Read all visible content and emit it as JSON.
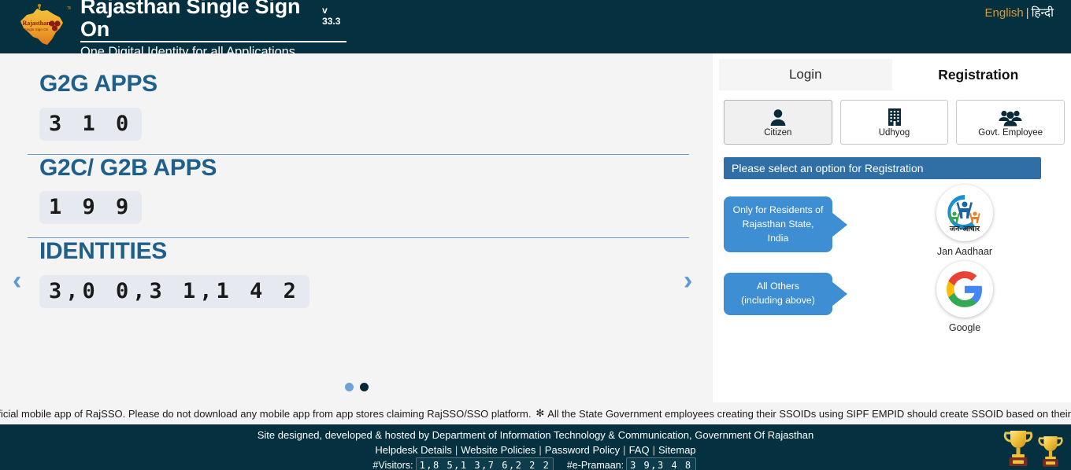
{
  "header": {
    "logo_alt": "rajasthan-sso-emblem",
    "title": "Rajasthan Single Sign On",
    "version": "v 33.3",
    "subtitle": "One Digital Identity for all Applications",
    "lang_english": "English",
    "lang_separator": "|",
    "lang_hindi": "हिन्दी",
    "bg_color": "#04303f",
    "accent_color": "#d79a3a"
  },
  "stats": {
    "items": [
      {
        "title": "G2G APPS",
        "value": "3 1 0"
      },
      {
        "title": "G2C/ G2B APPS",
        "value": "1 9 9"
      },
      {
        "title": "IDENTITIES",
        "value": "3,0 0,3 1,1 4 2"
      }
    ],
    "prev_arrow": "‹",
    "next_arrow": "›",
    "dots": 2,
    "active_dot": 2,
    "title_color": "#1f5f8b"
  },
  "panel": {
    "tabs": [
      {
        "label": "Login",
        "active": false
      },
      {
        "label": "Registration",
        "active": true
      }
    ],
    "roles": [
      {
        "label": "Citizen",
        "icon": "person-icon",
        "selected": true
      },
      {
        "label": "Udhyog",
        "icon": "building-icon",
        "selected": false
      },
      {
        "label": "Govt. Employee",
        "icon": "people-group-icon",
        "selected": false
      }
    ],
    "select_bar": "Please select an option for Registration",
    "select_bar_color": "#2f6fa5",
    "options": [
      {
        "callout_line1": "Only for Residents of",
        "callout_line2": "Rajasthan State, India",
        "caption": "Jan Aadhaar",
        "icon": "jan-aadhaar-logo",
        "logo_text": "जन-आधार"
      },
      {
        "callout_line1": "All Others",
        "callout_line2": "(including above)",
        "caption": "Google",
        "icon": "google-logo",
        "logo_text": "G"
      }
    ],
    "callout_color": "#3d8ed3"
  },
  "ticker": {
    "message_1": "fficial mobile app of RajSSO. Please do not download any mobile app from app stores claiming RajSSO/SSO platform.",
    "bullet": "✻",
    "message_2": "All the State Government employees creating their SSOIDs using SIPF EMPID should create SSOID based on their"
  },
  "footer": {
    "credit": "Site designed, developed & hosted by Department of Information Technology & Communication, Government Of Rajasthan",
    "links": [
      "Helpdesk Details",
      "Website Policies",
      "Password Policy",
      "FAQ",
      "Sitemap"
    ],
    "visitors_label": "#Visitors:",
    "visitors_value": "1,8 5,1 3,7 6,2 2 2",
    "pramaan_label": "#e-Pramaan:",
    "pramaan_value": "3 9,3 4 8",
    "trophy_icon": "trophy-icon",
    "trophy_count": 2
  }
}
